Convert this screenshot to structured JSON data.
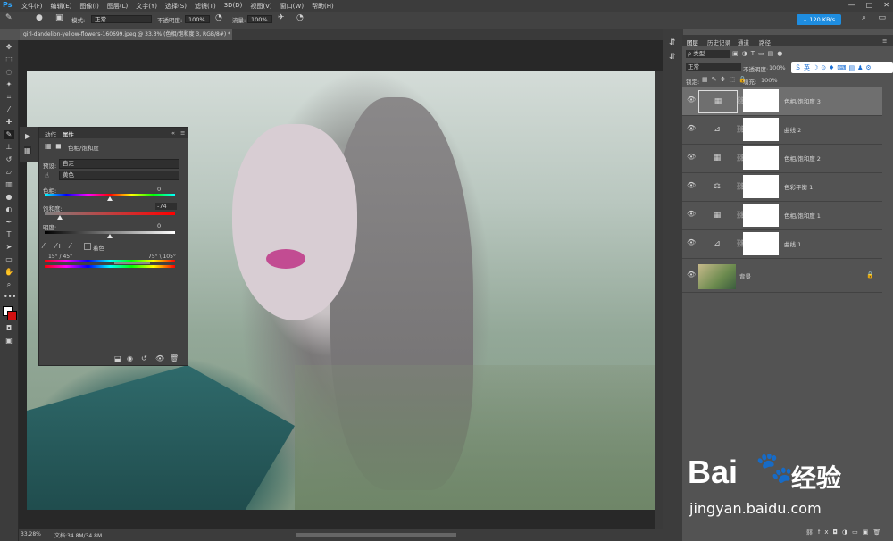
{
  "app": {
    "logo": "Ps"
  },
  "menu": [
    "文件(F)",
    "编辑(E)",
    "图像(I)",
    "图层(L)",
    "文字(Y)",
    "选择(S)",
    "滤镜(T)",
    "3D(D)",
    "视图(V)",
    "窗口(W)",
    "帮助(H)"
  ],
  "window_buttons": [
    "—",
    "□",
    "✕"
  ],
  "options": {
    "mode_label": "模式:",
    "mode_value": "正常",
    "opacity_label": "不透明度:",
    "opacity_value": "100%",
    "flow_label": "流量:",
    "flow_value": "100%",
    "net_speed": "↓ 120 KB/s"
  },
  "document": {
    "tab_title": "girl-dandelion-yellow-flowers-160699.jpeg @ 33.3% (色相/饱和度 3, RGB/8#) *",
    "close": "×",
    "zoom": "33.28%",
    "doc_info": "文档:34.8M/34.8M"
  },
  "properties": {
    "tabs": [
      "动作",
      "属性"
    ],
    "title": "色相/饱和度",
    "preset_label": "预设:",
    "preset_value": "自定",
    "channel_value": "黄色",
    "hue_label": "色相:",
    "hue_value": "0",
    "saturation_label": "饱和度:",
    "saturation_value": "-74",
    "lightness_label": "明度:",
    "lightness_value": "0",
    "colorize_label": "着色",
    "range_left": "15° / 45°",
    "range_right": "75° \\ 105°"
  },
  "layers_panel": {
    "tabs": [
      "图层",
      "历史记录",
      "通道",
      "路径"
    ],
    "filter_label": "ρ 类型",
    "blend_mode": "正常",
    "opacity_label": "不透明度:",
    "opacity_value": "100%",
    "lock_label": "锁定:",
    "fill_label": "填充:",
    "fill_value": "100%",
    "layers": [
      {
        "name": "色相/饱和度 3",
        "icon": "▦",
        "selected": true
      },
      {
        "name": "曲线 2",
        "icon": "⊿",
        "selected": false
      },
      {
        "name": "色相/饱和度 2",
        "icon": "▦",
        "selected": false
      },
      {
        "name": "色彩平衡 1",
        "icon": "⚖",
        "selected": false
      },
      {
        "name": "色相/饱和度 1",
        "icon": "▦",
        "selected": false
      },
      {
        "name": "曲线 1",
        "icon": "⊿",
        "selected": false
      }
    ],
    "background_layer": {
      "name": "背景",
      "lock": "🔒"
    }
  },
  "watermark": {
    "brand": "Bai",
    "brand_cn": "经验",
    "url": "jingyan.baidu.com"
  }
}
